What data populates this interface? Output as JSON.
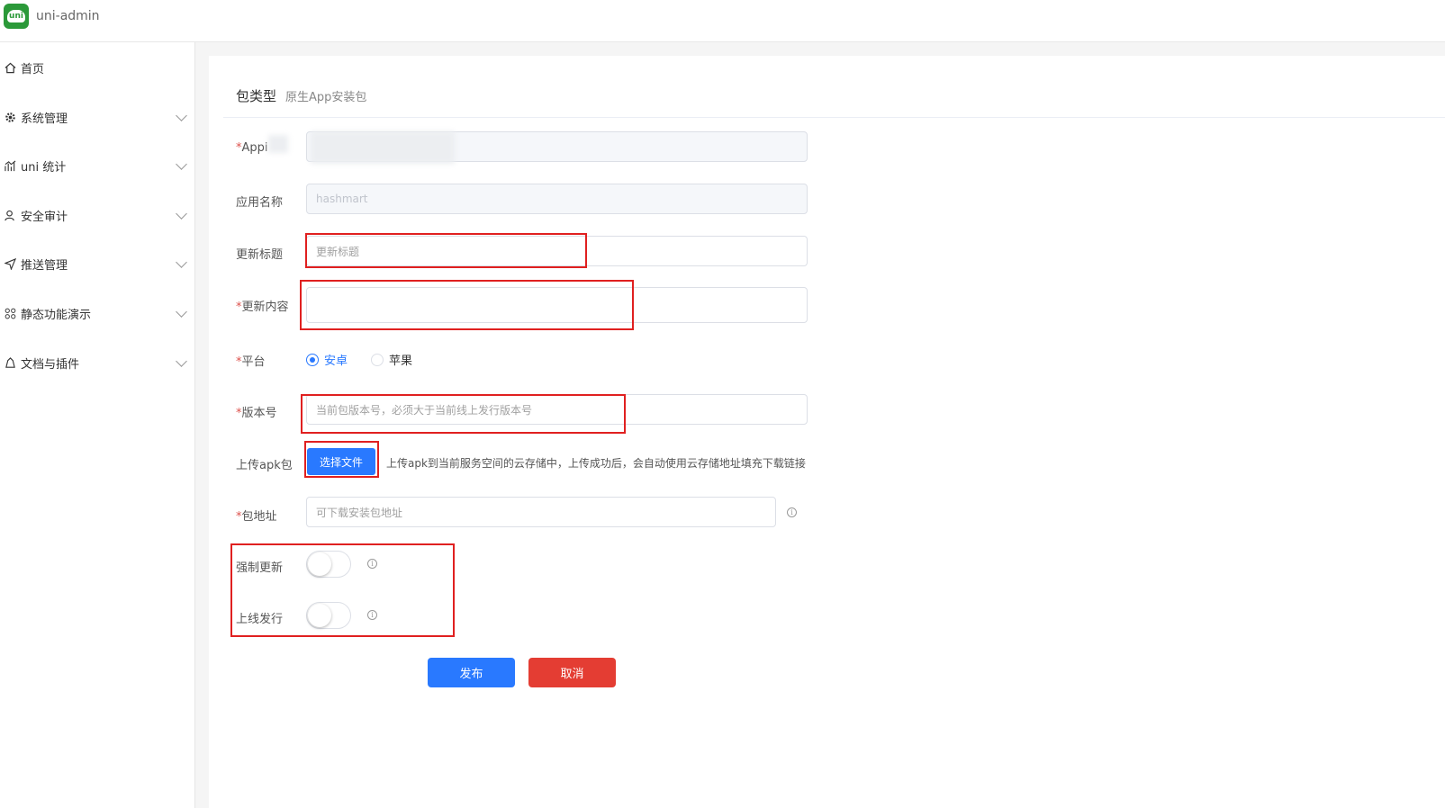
{
  "app": {
    "logo_text": "uni",
    "title": "uni-admin"
  },
  "sidebar": {
    "items": [
      {
        "label": "首页",
        "icon": "home-icon",
        "expandable": false
      },
      {
        "label": "系统管理",
        "icon": "gear-icon",
        "expandable": true
      },
      {
        "label": "uni 统计",
        "icon": "chart-icon",
        "expandable": true
      },
      {
        "label": "安全审计",
        "icon": "user-icon",
        "expandable": true
      },
      {
        "label": "推送管理",
        "icon": "send-icon",
        "expandable": true
      },
      {
        "label": "静态功能演示",
        "icon": "grid-icon",
        "expandable": true
      },
      {
        "label": "文档与插件",
        "icon": "plugin-icon",
        "expandable": true
      }
    ]
  },
  "form": {
    "header": {
      "label": "包类型",
      "value": "原生App安装包"
    },
    "appid": {
      "label": "Appi",
      "required": true
    },
    "app_name": {
      "label": "应用名称",
      "value": "hashmart"
    },
    "update_title": {
      "label": "更新标题",
      "placeholder": "更新标题"
    },
    "update_content": {
      "label": "更新内容",
      "required": true,
      "value": ""
    },
    "platform": {
      "label": "平台",
      "required": true,
      "options": [
        "安卓",
        "苹果"
      ],
      "selected": "安卓"
    },
    "version": {
      "label": "版本号",
      "required": true,
      "placeholder": "当前包版本号，必须大于当前线上发行版本号"
    },
    "upload": {
      "label": "上传apk包",
      "button": "选择文件",
      "hint": "上传apk到当前服务空间的云存储中，上传成功后，会自动使用云存储地址填充下载链接"
    },
    "url": {
      "label": "包地址",
      "required": true,
      "placeholder": "可下载安装包地址"
    },
    "force_update": {
      "label": "强制更新",
      "on": false
    },
    "online": {
      "label": "上线发行",
      "on": false
    },
    "submit_label": "发布",
    "cancel_label": "取消"
  },
  "colors": {
    "primary": "#2979ff",
    "danger": "#e43d33",
    "highlight": "#e02020",
    "logo": "#2b9939"
  }
}
